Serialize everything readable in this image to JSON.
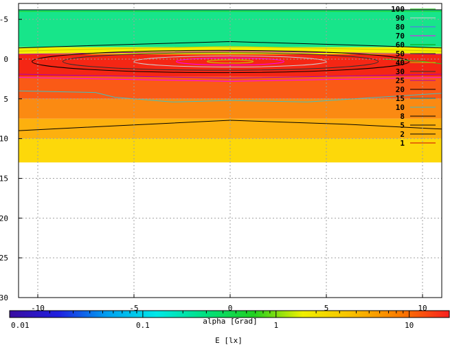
{
  "chart_data": {
    "type": "heatmap",
    "x_range": [
      -11,
      11
    ],
    "y_range": [
      -7,
      30
    ],
    "y_inverted": true,
    "x_ticks": [
      -10,
      -5,
      0,
      5,
      10
    ],
    "y_ticks": [
      -5,
      0,
      5,
      10,
      15,
      20,
      25,
      30
    ],
    "x_tick_labels": [
      "-10",
      "-5",
      "0",
      "5",
      "10"
    ],
    "y_tick_labels": [
      "-5",
      "0",
      "5",
      "10",
      "15",
      "20",
      "25",
      "30"
    ],
    "xlabel": "alpha [Grad]",
    "colorbar_label": "E [lx]",
    "grid": true,
    "data_extent_y": [
      -7,
      13
    ],
    "color_bands": [
      {
        "y_from": -6.2,
        "y_to": -1.5,
        "color": "#17e58a"
      },
      {
        "y_from": -1.5,
        "y_to": -0.6,
        "color": "#f3f000"
      },
      {
        "y_from": -0.6,
        "y_to": 2.2,
        "color": "#f52614"
      },
      {
        "y_from": 2.2,
        "y_to": 5.0,
        "color": "#fa5a16"
      },
      {
        "y_from": 5.0,
        "y_to": 7.5,
        "color": "#fb8a12"
      },
      {
        "y_from": 7.5,
        "y_to": 10.0,
        "color": "#fdb00e"
      },
      {
        "y_from": 10.0,
        "y_to": 13.0,
        "color": "#fdd80a"
      }
    ],
    "contour_levels": [
      {
        "value": "100",
        "color": "#25d125"
      },
      {
        "value": "90",
        "color": "#d0d0d0"
      },
      {
        "value": "80",
        "color": "#6060ff"
      },
      {
        "value": "70",
        "color": "#ff00ff"
      },
      {
        "value": "60",
        "color": "#00a000"
      },
      {
        "value": "50",
        "color": "#202020"
      },
      {
        "value": "40",
        "color": "#c8c800"
      },
      {
        "value": "30",
        "color": "#303030"
      },
      {
        "value": "25",
        "color": "#b000b0"
      },
      {
        "value": "20",
        "color": "#000000"
      },
      {
        "value": "15",
        "color": "#008080"
      },
      {
        "value": "10",
        "color": "#40c0c0"
      },
      {
        "value": "8",
        "color": "#000000"
      },
      {
        "value": "5",
        "color": "#000000"
      },
      {
        "value": "2",
        "color": "#000000"
      },
      {
        "value": "1",
        "color": "#d00000"
      }
    ],
    "colorbar": {
      "scale": "log",
      "range": [
        0.01,
        20
      ],
      "tick_labels": [
        "0.01",
        "0.1",
        "1",
        "10"
      ],
      "tick_values": [
        0.01,
        0.1,
        1,
        10
      ],
      "stops": [
        "#3a0ca0",
        "#2020e0",
        "#00a0f0",
        "#00e8e8",
        "#00e080",
        "#20d020",
        "#f0f000",
        "#f8c000",
        "#fa7a00",
        "#f82020"
      ]
    }
  }
}
